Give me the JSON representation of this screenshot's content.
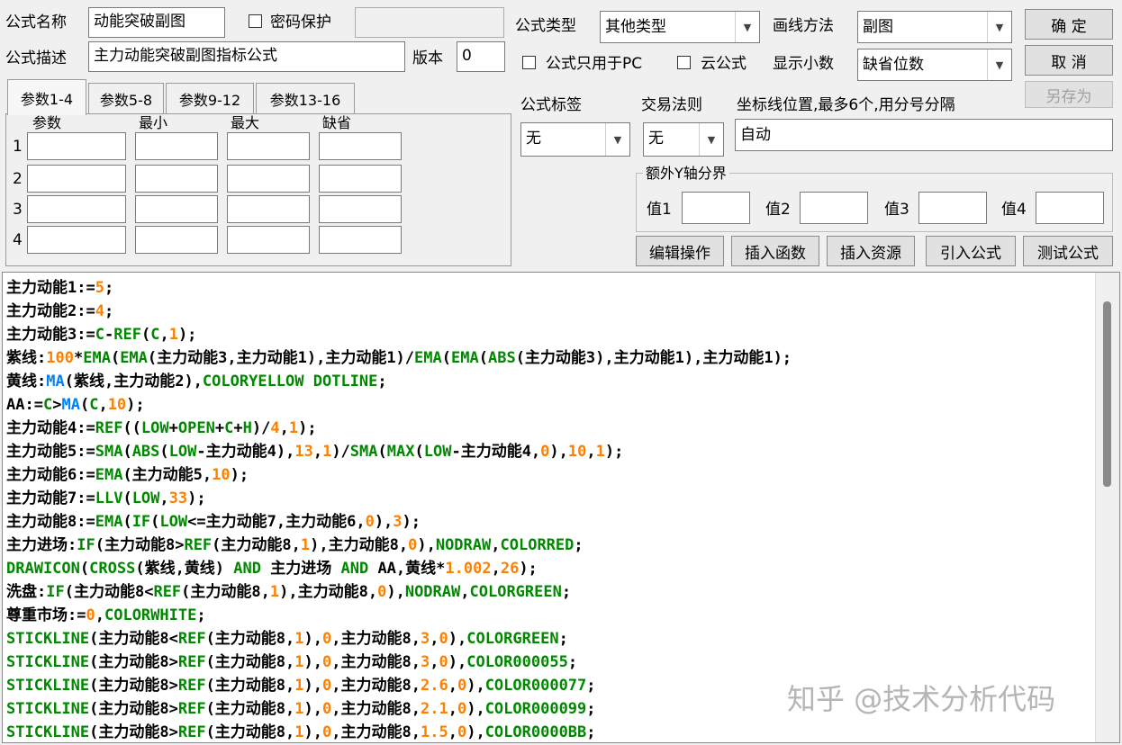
{
  "header": {
    "name_label": "公式名称",
    "name_value": "动能突破副图",
    "password_label": "密码保护",
    "desc_label": "公式描述",
    "desc_value": "主力动能突破副图指标公式",
    "version_label": "版本",
    "version_value": "0",
    "type_label": "公式类型",
    "type_value": "其他类型",
    "draw_label": "画线方法",
    "draw_value": "副图",
    "pc_only_label": "公式只用于PC",
    "cloud_label": "云公式",
    "decimals_label": "显示小数",
    "decimals_value": "缺省位数"
  },
  "buttons": {
    "ok": "确 定",
    "cancel": "取 消",
    "save_as": "另存为",
    "edit": "编辑操作",
    "insert_func": "插入函数",
    "insert_res": "插入资源",
    "import": "引入公式",
    "test": "测试公式"
  },
  "tabs": [
    "参数1-4",
    "参数5-8",
    "参数9-12",
    "参数13-16"
  ],
  "params": {
    "headers": [
      "参数",
      "最小",
      "最大",
      "缺省"
    ],
    "rows": [
      "1",
      "2",
      "3",
      "4"
    ]
  },
  "options": {
    "tag_label": "公式标签",
    "tag_value": "无",
    "rule_label": "交易法则",
    "rule_value": "无",
    "coord_label": "坐标线位置,最多6个,用分号分隔",
    "coord_value": "自动",
    "extra_axis_label": "额外Y轴分界",
    "v1": "值1",
    "v2": "值2",
    "v3": "值3",
    "v4": "值4"
  },
  "code_lines": [
    [
      [
        "t",
        "主力动能1:="
      ],
      [
        "n",
        "5"
      ],
      [
        "t",
        ";"
      ]
    ],
    [
      [
        "t",
        "主力动能2:="
      ],
      [
        "n",
        "4"
      ],
      [
        "t",
        ";"
      ]
    ],
    [
      [
        "t",
        "主力动能3:="
      ],
      [
        "f",
        "C"
      ],
      [
        "t",
        "-"
      ],
      [
        "f",
        "REF"
      ],
      [
        "t",
        "("
      ],
      [
        "f",
        "C"
      ],
      [
        "t",
        ","
      ],
      [
        "n",
        "1"
      ],
      [
        "t",
        ");"
      ]
    ],
    [
      [
        "t",
        "紫线:"
      ],
      [
        "n",
        "100"
      ],
      [
        "t",
        "*"
      ],
      [
        "f",
        "EMA"
      ],
      [
        "t",
        "("
      ],
      [
        "f",
        "EMA"
      ],
      [
        "t",
        "(主力动能3,主力动能1),主力动能1)/"
      ],
      [
        "f",
        "EMA"
      ],
      [
        "t",
        "("
      ],
      [
        "f",
        "EMA"
      ],
      [
        "t",
        "("
      ],
      [
        "f",
        "ABS"
      ],
      [
        "t",
        "(主力动能3),主力动能1),主力动能1);"
      ]
    ],
    [
      [
        "t",
        "黄线:"
      ],
      [
        "b",
        "MA"
      ],
      [
        "t",
        "(紫线,主力动能2),"
      ],
      [
        "f",
        "COLORYELLOW DOTLINE"
      ],
      [
        "t",
        ";"
      ]
    ],
    [
      [
        "t",
        "AA:="
      ],
      [
        "f",
        "C"
      ],
      [
        "t",
        ">"
      ],
      [
        "b",
        "MA"
      ],
      [
        "t",
        "("
      ],
      [
        "f",
        "C"
      ],
      [
        "t",
        ","
      ],
      [
        "n",
        "10"
      ],
      [
        "t",
        ");"
      ]
    ],
    [
      [
        "t",
        "主力动能4:="
      ],
      [
        "f",
        "REF"
      ],
      [
        "t",
        "(("
      ],
      [
        "f",
        "LOW"
      ],
      [
        "t",
        "+"
      ],
      [
        "f",
        "OPEN"
      ],
      [
        "t",
        "+"
      ],
      [
        "f",
        "C"
      ],
      [
        "t",
        "+"
      ],
      [
        "f",
        "H"
      ],
      [
        "t",
        ")/"
      ],
      [
        "n",
        "4"
      ],
      [
        "t",
        ","
      ],
      [
        "n",
        "1"
      ],
      [
        "t",
        ");"
      ]
    ],
    [
      [
        "t",
        "主力动能5:="
      ],
      [
        "f",
        "SMA"
      ],
      [
        "t",
        "("
      ],
      [
        "f",
        "ABS"
      ],
      [
        "t",
        "("
      ],
      [
        "f",
        "LOW"
      ],
      [
        "t",
        "-主力动能4),"
      ],
      [
        "n",
        "13"
      ],
      [
        "t",
        ","
      ],
      [
        "n",
        "1"
      ],
      [
        "t",
        ")/"
      ],
      [
        "f",
        "SMA"
      ],
      [
        "t",
        "("
      ],
      [
        "f",
        "MAX"
      ],
      [
        "t",
        "("
      ],
      [
        "f",
        "LOW"
      ],
      [
        "t",
        "-主力动能4,"
      ],
      [
        "n",
        "0"
      ],
      [
        "t",
        "),"
      ],
      [
        "n",
        "10"
      ],
      [
        "t",
        ","
      ],
      [
        "n",
        "1"
      ],
      [
        "t",
        ");"
      ]
    ],
    [
      [
        "t",
        "主力动能6:="
      ],
      [
        "f",
        "EMA"
      ],
      [
        "t",
        "(主力动能5,"
      ],
      [
        "n",
        "10"
      ],
      [
        "t",
        ");"
      ]
    ],
    [
      [
        "t",
        "主力动能7:="
      ],
      [
        "f",
        "LLV"
      ],
      [
        "t",
        "("
      ],
      [
        "f",
        "LOW"
      ],
      [
        "t",
        ","
      ],
      [
        "n",
        "33"
      ],
      [
        "t",
        ");"
      ]
    ],
    [
      [
        "t",
        "主力动能8:="
      ],
      [
        "f",
        "EMA"
      ],
      [
        "t",
        "("
      ],
      [
        "f",
        "IF"
      ],
      [
        "t",
        "("
      ],
      [
        "f",
        "LOW"
      ],
      [
        "t",
        "<=主力动能7,主力动能6,"
      ],
      [
        "n",
        "0"
      ],
      [
        "t",
        "),"
      ],
      [
        "n",
        "3"
      ],
      [
        "t",
        ");"
      ]
    ],
    [
      [
        "t",
        "主力进场:"
      ],
      [
        "f",
        "IF"
      ],
      [
        "t",
        "(主力动能8>"
      ],
      [
        "f",
        "REF"
      ],
      [
        "t",
        "(主力动能8,"
      ],
      [
        "n",
        "1"
      ],
      [
        "t",
        "),主力动能8,"
      ],
      [
        "n",
        "0"
      ],
      [
        "t",
        "),"
      ],
      [
        "f",
        "NODRAW"
      ],
      [
        "t",
        ","
      ],
      [
        "f",
        "COLORRED"
      ],
      [
        "t",
        ";"
      ]
    ],
    [
      [
        "f",
        "DRAWICON"
      ],
      [
        "t",
        "("
      ],
      [
        "f",
        "CROSS"
      ],
      [
        "t",
        "(紫线,黄线) "
      ],
      [
        "f",
        "AND"
      ],
      [
        "t",
        " 主力进场 "
      ],
      [
        "f",
        "AND"
      ],
      [
        "t",
        " AA,黄线*"
      ],
      [
        "n",
        "1.002"
      ],
      [
        "t",
        ","
      ],
      [
        "n",
        "26"
      ],
      [
        "t",
        ");"
      ]
    ],
    [
      [
        "t",
        "洗盘:"
      ],
      [
        "f",
        "IF"
      ],
      [
        "t",
        "(主力动能8<"
      ],
      [
        "f",
        "REF"
      ],
      [
        "t",
        "(主力动能8,"
      ],
      [
        "n",
        "1"
      ],
      [
        "t",
        "),主力动能8,"
      ],
      [
        "n",
        "0"
      ],
      [
        "t",
        "),"
      ],
      [
        "f",
        "NODRAW"
      ],
      [
        "t",
        ","
      ],
      [
        "f",
        "COLORGREEN"
      ],
      [
        "t",
        ";"
      ]
    ],
    [
      [
        "t",
        "尊重市场:="
      ],
      [
        "n",
        "0"
      ],
      [
        "t",
        ","
      ],
      [
        "f",
        "COLORWHITE"
      ],
      [
        "t",
        ";"
      ]
    ],
    [
      [
        "f",
        "STICKLINE"
      ],
      [
        "t",
        "(主力动能8<"
      ],
      [
        "f",
        "REF"
      ],
      [
        "t",
        "(主力动能8,"
      ],
      [
        "n",
        "1"
      ],
      [
        "t",
        "),"
      ],
      [
        "n",
        "0"
      ],
      [
        "t",
        ",主力动能8,"
      ],
      [
        "n",
        "3"
      ],
      [
        "t",
        ","
      ],
      [
        "n",
        "0"
      ],
      [
        "t",
        "),"
      ],
      [
        "f",
        "COLORGREEN"
      ],
      [
        "t",
        ";"
      ]
    ],
    [
      [
        "f",
        "STICKLINE"
      ],
      [
        "t",
        "(主力动能8>"
      ],
      [
        "f",
        "REF"
      ],
      [
        "t",
        "(主力动能8,"
      ],
      [
        "n",
        "1"
      ],
      [
        "t",
        "),"
      ],
      [
        "n",
        "0"
      ],
      [
        "t",
        ",主力动能8,"
      ],
      [
        "n",
        "3"
      ],
      [
        "t",
        ","
      ],
      [
        "n",
        "0"
      ],
      [
        "t",
        "),"
      ],
      [
        "f",
        "COLOR000055"
      ],
      [
        "t",
        ";"
      ]
    ],
    [
      [
        "f",
        "STICKLINE"
      ],
      [
        "t",
        "(主力动能8>"
      ],
      [
        "f",
        "REF"
      ],
      [
        "t",
        "(主力动能8,"
      ],
      [
        "n",
        "1"
      ],
      [
        "t",
        "),"
      ],
      [
        "n",
        "0"
      ],
      [
        "t",
        ",主力动能8,"
      ],
      [
        "n",
        "2.6"
      ],
      [
        "t",
        ","
      ],
      [
        "n",
        "0"
      ],
      [
        "t",
        "),"
      ],
      [
        "f",
        "COLOR000077"
      ],
      [
        "t",
        ";"
      ]
    ],
    [
      [
        "f",
        "STICKLINE"
      ],
      [
        "t",
        "(主力动能8>"
      ],
      [
        "f",
        "REF"
      ],
      [
        "t",
        "(主力动能8,"
      ],
      [
        "n",
        "1"
      ],
      [
        "t",
        "),"
      ],
      [
        "n",
        "0"
      ],
      [
        "t",
        ",主力动能8,"
      ],
      [
        "n",
        "2.1"
      ],
      [
        "t",
        ","
      ],
      [
        "n",
        "0"
      ],
      [
        "t",
        "),"
      ],
      [
        "f",
        "COLOR000099"
      ],
      [
        "t",
        ";"
      ]
    ],
    [
      [
        "f",
        "STICKLINE"
      ],
      [
        "t",
        "(主力动能8>"
      ],
      [
        "f",
        "REF"
      ],
      [
        "t",
        "(主力动能8,"
      ],
      [
        "n",
        "1"
      ],
      [
        "t",
        "),"
      ],
      [
        "n",
        "0"
      ],
      [
        "t",
        ",主力动能8,"
      ],
      [
        "n",
        "1.5"
      ],
      [
        "t",
        ","
      ],
      [
        "n",
        "0"
      ],
      [
        "t",
        "),"
      ],
      [
        "f",
        "COLOR0000BB"
      ],
      [
        "t",
        ";"
      ]
    ]
  ],
  "watermark": "知乎 @技术分析代码",
  "colors": {
    "text": "#000000",
    "number": "#ff8000",
    "function": "#008800",
    "ma": "#0080ff"
  }
}
